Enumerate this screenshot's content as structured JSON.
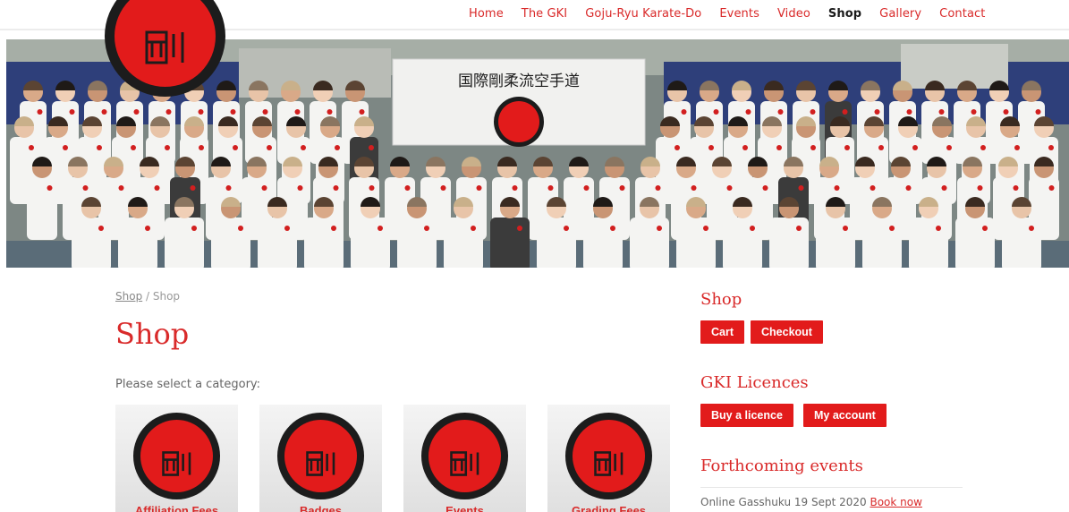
{
  "nav": {
    "items": [
      {
        "label": "Home",
        "active": false
      },
      {
        "label": "The GKI",
        "active": false
      },
      {
        "label": "Goju-Ryu Karate-Do",
        "active": false
      },
      {
        "label": "Events",
        "active": false
      },
      {
        "label": "Video",
        "active": false
      },
      {
        "label": "Shop",
        "active": true
      },
      {
        "label": "Gallery",
        "active": false
      },
      {
        "label": "Contact",
        "active": false
      }
    ]
  },
  "hero": {
    "banner_text": "国際剛柔流空手道"
  },
  "breadcrumb": {
    "link": "Shop",
    "separator": " / ",
    "current": "Shop"
  },
  "main": {
    "title": "Shop",
    "select_text": "Please select a category:",
    "categories": [
      {
        "label": "Affiliation Fees"
      },
      {
        "label": "Badges"
      },
      {
        "label": "Events"
      },
      {
        "label": "Grading Fees"
      }
    ]
  },
  "sidebar": {
    "shop_heading": "Shop",
    "cart_label": "Cart",
    "checkout_label": "Checkout",
    "licences_heading": "GKI Licences",
    "buy_licence_label": "Buy a licence",
    "my_account_label": "My account",
    "events_heading": "Forthcoming events",
    "event_text": "Online Gasshuku 19 Sept 2020 ",
    "event_link": "Book now"
  },
  "colors": {
    "accent": "#d92a2a",
    "button": "#e21b1b",
    "logo_ring": "#1c1c1c"
  }
}
